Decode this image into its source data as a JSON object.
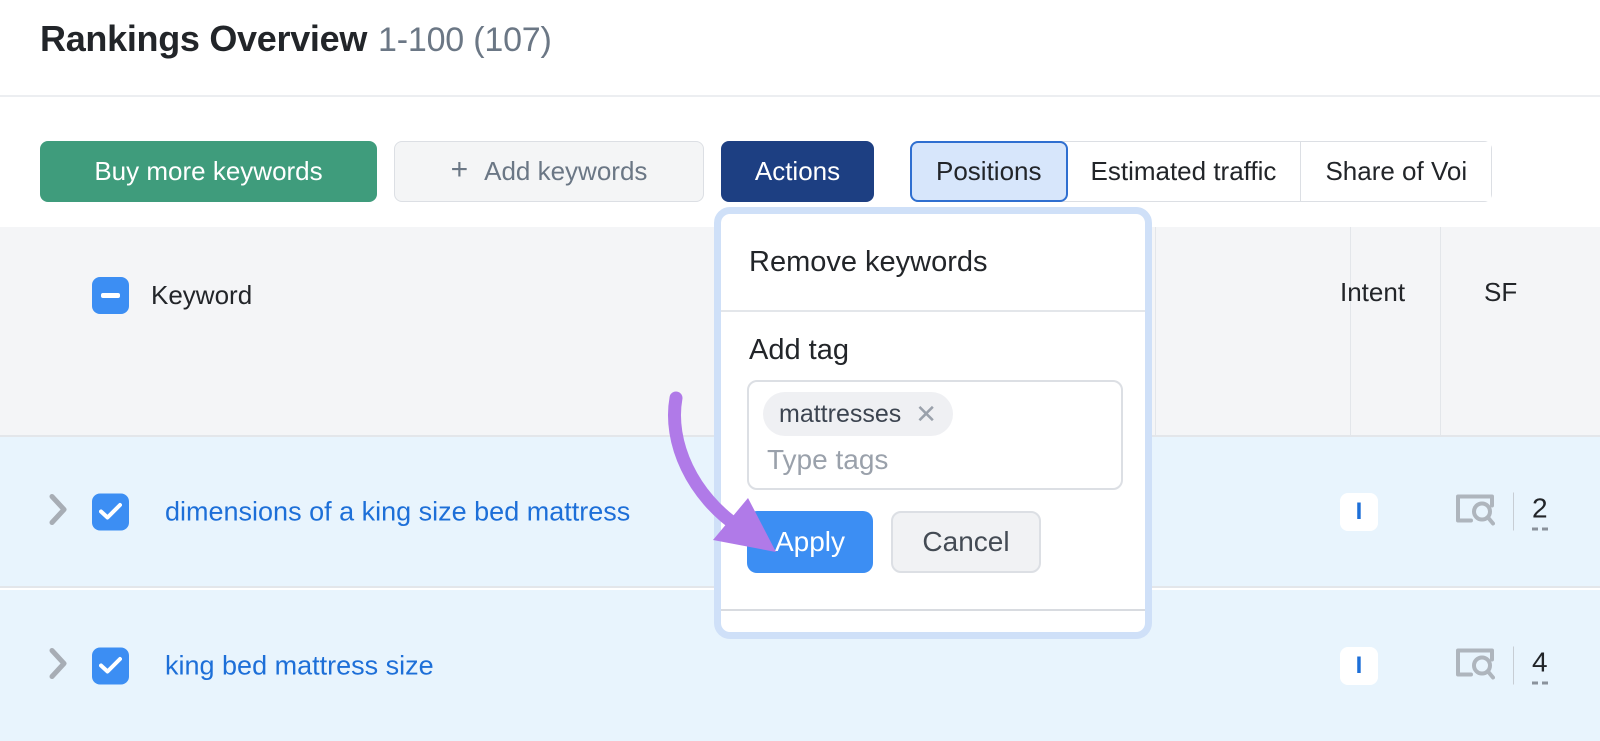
{
  "header": {
    "title": "Rankings Overview",
    "subtitle": "1-100 (107)"
  },
  "toolbar": {
    "buy_more_keywords": "Buy more keywords",
    "add_keywords": "Add keywords",
    "add_keywords_icon": "plus-icon",
    "actions": "Actions",
    "view_tabs": [
      {
        "label": "Positions",
        "active": true
      },
      {
        "label": "Estimated traffic",
        "active": false
      },
      {
        "label": "Share of Voi",
        "active": false
      }
    ]
  },
  "table": {
    "header": {
      "select_all_state": "indeterminate",
      "keyword_label": "Keyword",
      "intent_label": "Intent",
      "sf_label": "SF"
    },
    "rows": [
      {
        "expand_icon": "chevron-right-icon",
        "checked": true,
        "keyword": "dimensions of a king size bed mattress",
        "intent": "I",
        "serp_features_icon": "serp-features-icon",
        "sf_count": "2"
      },
      {
        "expand_icon": "chevron-right-icon",
        "checked": true,
        "keyword": "king bed mattress size",
        "intent": "I",
        "serp_features_icon": "serp-features-icon",
        "sf_count": "4"
      }
    ]
  },
  "actions_dropdown": {
    "remove_keywords": "Remove keywords",
    "add_tag_label": "Add tag",
    "tag_chip": "mattresses",
    "tag_chip_remove_icon": "close-icon",
    "tag_placeholder": "Type tags",
    "apply": "Apply",
    "cancel": "Cancel"
  },
  "annotation": {
    "arrow_color": "#b07ae8",
    "points_to": "apply-button"
  },
  "colors": {
    "green": "#3f9c7c",
    "navy": "#1d3f82",
    "blue": "#3c8ef3",
    "link_blue": "#1d6fd8",
    "row_selected": "#e8f4fd",
    "header_bg": "#f4f5f7",
    "dropdown_ring": "#cfe0f8"
  }
}
